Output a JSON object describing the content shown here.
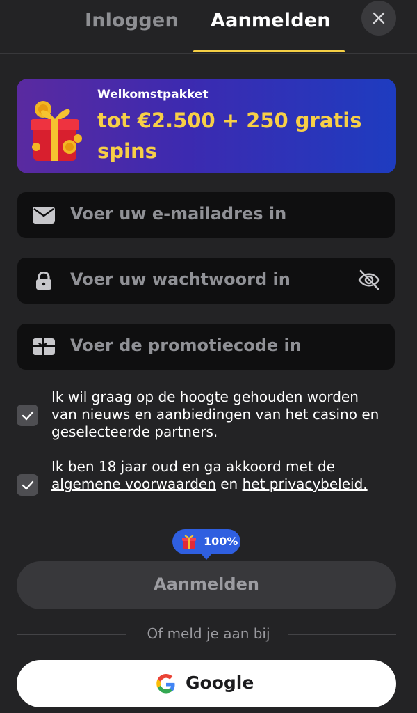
{
  "tabs": {
    "login": "Inloggen",
    "signup": "Aanmelden"
  },
  "promo": {
    "title": "Welkomstpakket",
    "amount": "tot €2.500 + 250 gratis spins"
  },
  "fields": {
    "email_placeholder": "Voer uw e-mailadres in",
    "password_placeholder": "Voer uw wachtwoord in",
    "promo_placeholder": "Voer de promotiecode in"
  },
  "checks": {
    "news": {
      "text": "Ik wil graag op de hoogte gehouden worden van nieuws en aanbiedingen van het casino en geselecteerde partners.",
      "checked": true
    },
    "terms": {
      "prefix": "Ik ben 18 jaar oud en ga akkoord met de",
      "terms_link": "algemene voorwaarden",
      "mid": "en",
      "privacy_link": "het privacybeleid.",
      "checked": true
    }
  },
  "bonus_badge": "100%",
  "submit_label": "Aanmelden",
  "divider_text": "Of meld je aan bij",
  "google_label": "Google",
  "colors": {
    "accent": "#f5cf45",
    "background": "#232325",
    "field": "#0f0f10",
    "badge": "#2f5fe0"
  },
  "icons": [
    "close-icon",
    "gift-icon",
    "mail-icon",
    "lock-icon",
    "eye-off-icon",
    "promo-card-icon",
    "check-icon",
    "google-icon"
  ]
}
